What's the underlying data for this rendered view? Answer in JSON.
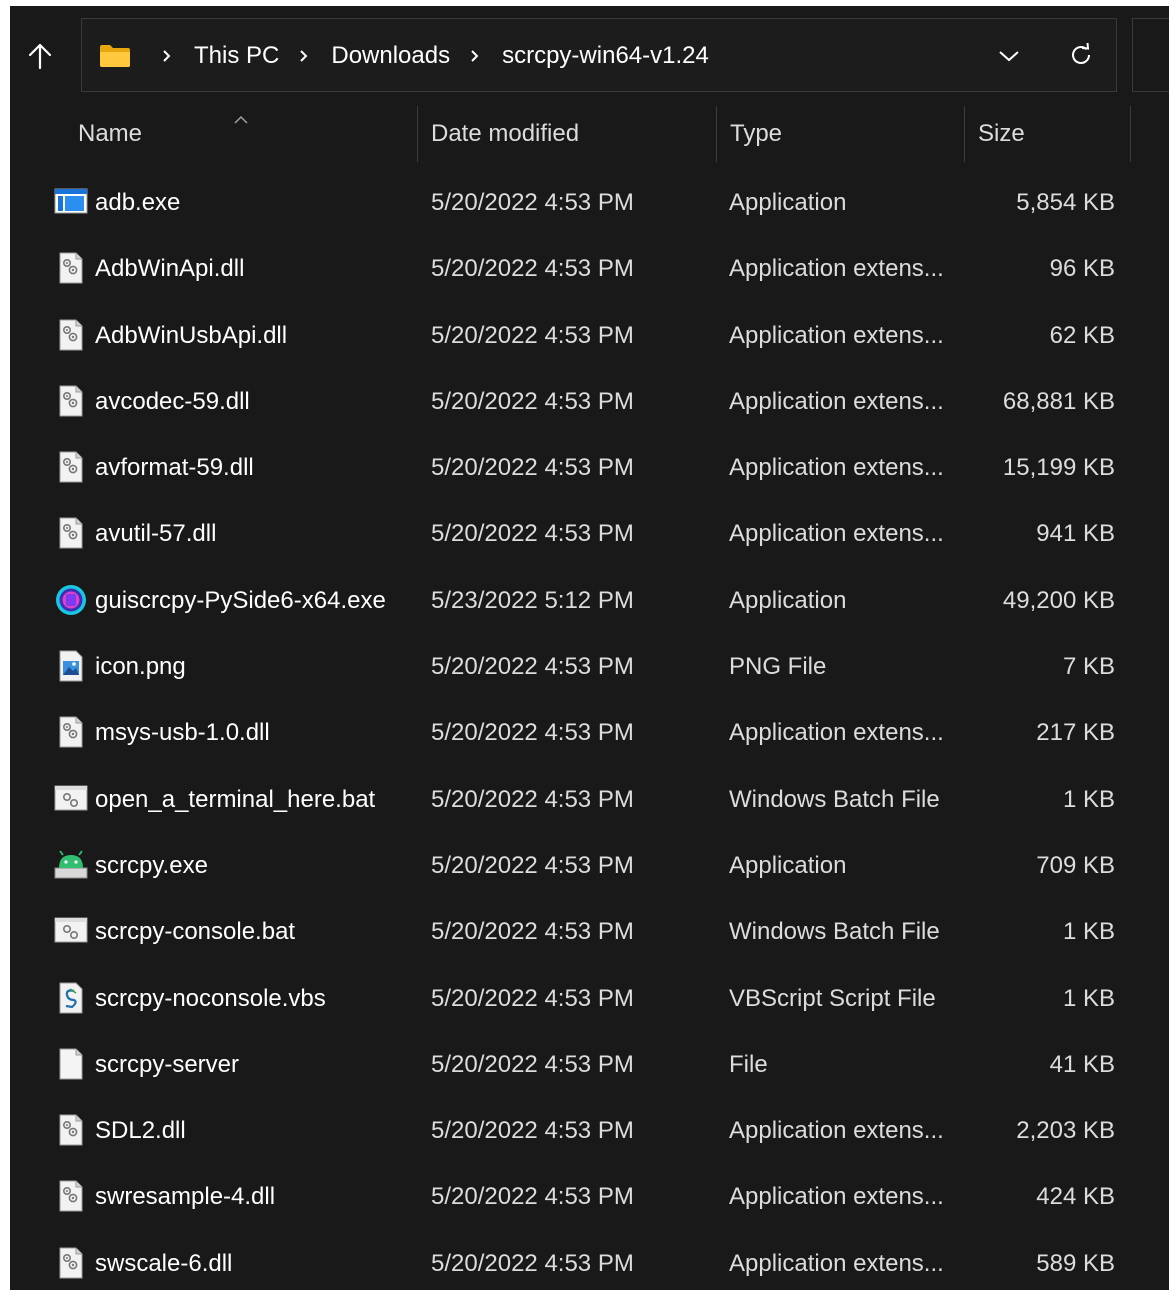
{
  "window": {
    "background": "#191919",
    "text_color": "#ffffff"
  },
  "address_bar": {
    "up_icon": "arrow-up-icon",
    "folder_icon": "folder-icon",
    "breadcrumbs": [
      "This PC",
      "Downloads",
      "scrcpy-win64-v1.24"
    ],
    "dropdown_icon": "chevron-down-icon",
    "refresh_icon": "refresh-icon"
  },
  "columns": {
    "name": "Name",
    "date": "Date modified",
    "type": "Type",
    "size": "Size",
    "sorted_by": "name",
    "sort_direction": "ascending"
  },
  "files": [
    {
      "name": "adb.exe",
      "date": "5/20/2022 4:53 PM",
      "type": "Application",
      "size": "5,854 KB",
      "icon": "application-window-icon"
    },
    {
      "name": "AdbWinApi.dll",
      "date": "5/20/2022 4:53 PM",
      "type": "Application extens...",
      "size": "96 KB",
      "icon": "dll-file-icon"
    },
    {
      "name": "AdbWinUsbApi.dll",
      "date": "5/20/2022 4:53 PM",
      "type": "Application extens...",
      "size": "62 KB",
      "icon": "dll-file-icon"
    },
    {
      "name": "avcodec-59.dll",
      "date": "5/20/2022 4:53 PM",
      "type": "Application extens...",
      "size": "68,881 KB",
      "icon": "dll-file-icon"
    },
    {
      "name": "avformat-59.dll",
      "date": "5/20/2022 4:53 PM",
      "type": "Application extens...",
      "size": "15,199 KB",
      "icon": "dll-file-icon"
    },
    {
      "name": "avutil-57.dll",
      "date": "5/20/2022 4:53 PM",
      "type": "Application extens...",
      "size": "941 KB",
      "icon": "dll-file-icon"
    },
    {
      "name": "guiscrcpy-PySide6-x64.exe",
      "date": "5/23/2022 5:12 PM",
      "type": "Application",
      "size": "49,200 KB",
      "icon": "guiscrcpy-app-icon"
    },
    {
      "name": "icon.png",
      "date": "5/20/2022 4:53 PM",
      "type": "PNG File",
      "size": "7 KB",
      "icon": "image-file-icon"
    },
    {
      "name": "msys-usb-1.0.dll",
      "date": "5/20/2022 4:53 PM",
      "type": "Application extens...",
      "size": "217 KB",
      "icon": "dll-file-icon"
    },
    {
      "name": "open_a_terminal_here.bat",
      "date": "5/20/2022 4:53 PM",
      "type": "Windows Batch File",
      "size": "1 KB",
      "icon": "batch-file-icon"
    },
    {
      "name": "scrcpy.exe",
      "date": "5/20/2022 4:53 PM",
      "type": "Application",
      "size": "709 KB",
      "icon": "android-app-icon"
    },
    {
      "name": "scrcpy-console.bat",
      "date": "5/20/2022 4:53 PM",
      "type": "Windows Batch File",
      "size": "1 KB",
      "icon": "batch-file-icon"
    },
    {
      "name": "scrcpy-noconsole.vbs",
      "date": "5/20/2022 4:53 PM",
      "type": "VBScript Script File",
      "size": "1 KB",
      "icon": "vbscript-file-icon"
    },
    {
      "name": "scrcpy-server",
      "date": "5/20/2022 4:53 PM",
      "type": "File",
      "size": "41 KB",
      "icon": "blank-file-icon"
    },
    {
      "name": "SDL2.dll",
      "date": "5/20/2022 4:53 PM",
      "type": "Application extens...",
      "size": "2,203 KB",
      "icon": "dll-file-icon"
    },
    {
      "name": "swresample-4.dll",
      "date": "5/20/2022 4:53 PM",
      "type": "Application extens...",
      "size": "424 KB",
      "icon": "dll-file-icon"
    },
    {
      "name": "swscale-6.dll",
      "date": "5/20/2022 4:53 PM",
      "type": "Application extens...",
      "size": "589 KB",
      "icon": "dll-file-icon"
    }
  ]
}
